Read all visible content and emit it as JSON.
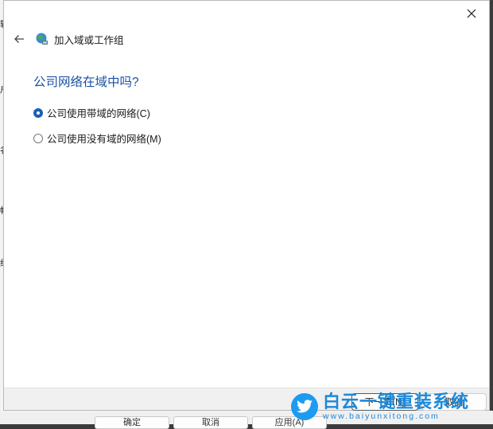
{
  "background": {
    "left_strip_glyphs": [
      "转",
      "户",
      "名",
      "帐",
      "组"
    ],
    "bottom_buttons": [
      "确定",
      "取消",
      "应用(A)"
    ]
  },
  "dialog": {
    "title": "加入域或工作组",
    "heading": "公司网络在域中吗?",
    "options": [
      {
        "label": "公司使用带域的网络(C)",
        "checked": true
      },
      {
        "label": "公司使用没有域的网络(M)",
        "checked": false
      }
    ],
    "buttons": {
      "next": "下一页(N)",
      "cancel": "取消"
    }
  },
  "watermark": {
    "title": "白云一键重装系统",
    "url": "www.baiyunxitong.com"
  },
  "colors": {
    "accent": "#1b5fb8",
    "heading": "#1a52a6",
    "watermark": "#1d88d8"
  },
  "icons": {
    "close": "close-icon",
    "back": "back-arrow-icon",
    "app": "network-globe-icon",
    "watermark": "twitter-bird-icon"
  }
}
